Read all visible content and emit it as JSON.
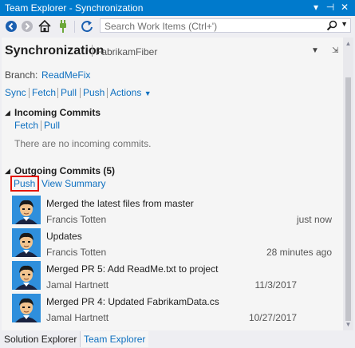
{
  "window": {
    "title": "Team Explorer - Synchronization",
    "controls": {
      "dropdown": "▾",
      "pin": "⊣",
      "close": "✕"
    }
  },
  "toolbar": {
    "search_placeholder": "Search Work Items (Ctrl+')"
  },
  "page": {
    "title": "Synchronization",
    "subtitle": "FabrikamFiber"
  },
  "branch": {
    "label": "Branch:",
    "value": "ReadMeFix"
  },
  "actions": {
    "sync": "Sync",
    "fetch": "Fetch",
    "pull": "Pull",
    "push": "Push",
    "more": "Actions"
  },
  "incoming": {
    "heading": "Incoming Commits",
    "fetch": "Fetch",
    "pull": "Pull",
    "empty_message": "There are no incoming commits."
  },
  "outgoing": {
    "heading": "Outgoing Commits (5)",
    "push": "Push",
    "view_summary": "View Summary",
    "commits": [
      {
        "title": "Merged the latest files from master",
        "author": "Francis Totten",
        "time": "just now"
      },
      {
        "title": "Updates",
        "author": "Francis Totten",
        "time": "28 minutes ago"
      },
      {
        "title": "Merged PR 5: Add ReadMe.txt to project",
        "author": "Jamal Hartnett",
        "time": "11/3/2017"
      },
      {
        "title": "Merged PR 4: Updated FabrikamData.cs",
        "author": "Jamal Hartnett",
        "time": "10/27/2017"
      }
    ]
  },
  "bottom_tabs": {
    "solution_explorer": "Solution Explorer",
    "team_explorer": "Team Explorer"
  },
  "colors": {
    "accent": "#007acc",
    "link": "#0e70c0",
    "highlight": "#e51400",
    "sync_icon": "#6ca83a"
  }
}
